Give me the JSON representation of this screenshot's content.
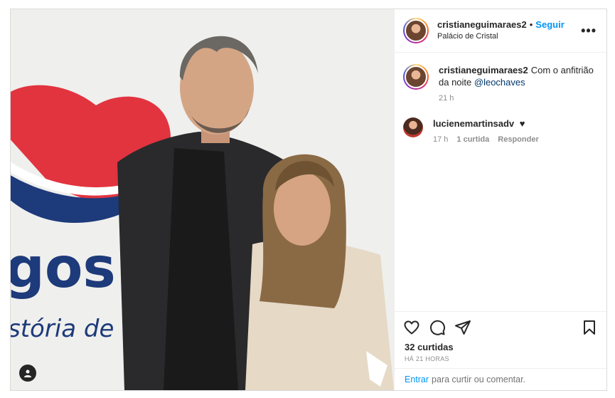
{
  "post": {
    "username": "cristianeguimaraes2",
    "follow_label": "Seguir",
    "location": "Palácio de Cristal",
    "more_label": "•••"
  },
  "caption": {
    "username": "cristianeguimaraes2",
    "text": "Com o anfitrião da noite",
    "mention": "@leochaves",
    "time": "21 h"
  },
  "comments": [
    {
      "username": "lucienemartinsadv",
      "text": "♥",
      "time": "17 h",
      "likes": "1 curtida",
      "reply_label": "Responder"
    }
  ],
  "stats": {
    "likes": "32 curtidas",
    "posted": "HÁ 21 HORAS"
  },
  "add_comment": {
    "login_link": "Entrar",
    "prompt": "para curtir ou comentar."
  },
  "photo": {
    "banner_text_1": "gos",
    "banner_text_2": "stória de"
  },
  "icons": {
    "heart": "heart-icon",
    "comment": "comment-icon",
    "share": "share-icon",
    "save": "bookmark-icon",
    "tag": "user-tag-icon"
  },
  "colors": {
    "accent": "#0095f6",
    "banner_red": "#e63946",
    "banner_navy": "#1d3a7a"
  }
}
